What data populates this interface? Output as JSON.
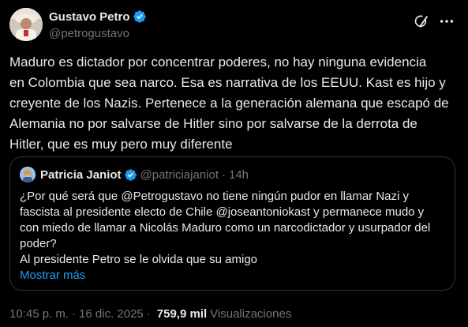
{
  "author": {
    "display_name": "Gustavo Petro",
    "handle": "@petrogustavo",
    "verified_icon": "verified-badge-icon",
    "verified_color": "#1d9bf0"
  },
  "actions": {
    "grok_icon": "grok-icon",
    "more_icon": "more-icon"
  },
  "tweet": {
    "text": "Maduro es dictador por concentrar poderes, no hay ninguna evidencia\nen Colombia que sea narco. Esa es narrativa de los EEUU. Kast es hijo y\ncreyente de los Nazis. Pertenece a la generación alemana que escapó de\nAlemania no por salvarse de Hitler sino por salvarse de la derrota de\nHitler, que es muy pero muy diferente"
  },
  "quote": {
    "display_name": "Patricia Janiot",
    "handle": "@patriciajaniot",
    "separator": "·",
    "time": "14h",
    "text": "¿Por qué será que @Petrogustavo no tiene ningún pudor en llamar Nazi y\nfascista al presidente electo de Chile @joseantoniokast y permanece mudo y\ncon miedo de llamar a Nicolás Maduro como un narcodictador y usurpador del\npoder?\nAl presidente Petro se le olvida que su amigo",
    "show_more": "Mostrar más"
  },
  "meta": {
    "time": "10:45 p. m.",
    "dot": "·",
    "date": "16 dic. 2025",
    "views_count": "759,9 mil",
    "views_label": "Visualizaciones"
  },
  "colors": {
    "background": "#000000",
    "text": "#e7e9ea",
    "secondary": "#71767b",
    "link": "#1d9bf0",
    "border": "#2f3336"
  }
}
